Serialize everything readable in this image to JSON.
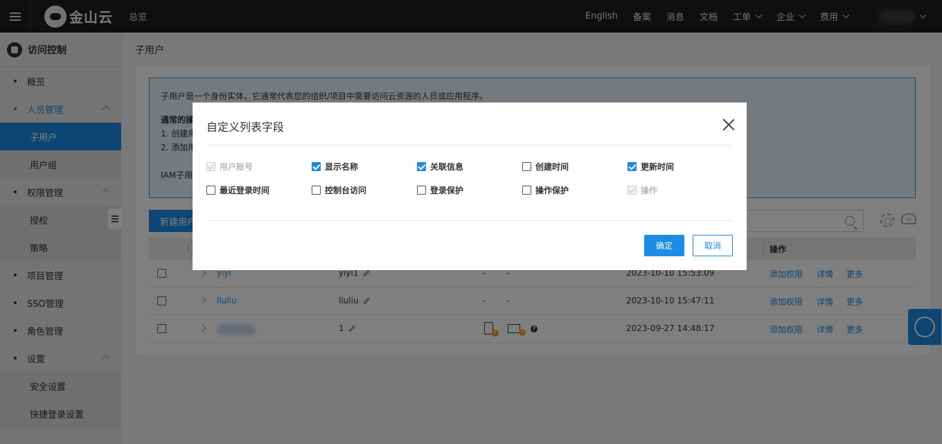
{
  "topbar": {
    "brand": "金山云",
    "overview": "总览",
    "items": [
      {
        "label": "English"
      },
      {
        "label": "备案"
      },
      {
        "label": "消息"
      },
      {
        "label": "文档"
      },
      {
        "label": "工单"
      },
      {
        "label": "企业"
      },
      {
        "label": "费用"
      }
    ]
  },
  "sidebar": {
    "title": "访问控制",
    "items": [
      {
        "label": "概览"
      },
      {
        "label": "人员管理"
      },
      {
        "label": "子用户"
      },
      {
        "label": "用户组"
      },
      {
        "label": "权限管理"
      },
      {
        "label": "授权"
      },
      {
        "label": "策略"
      },
      {
        "label": "项目管理"
      },
      {
        "label": "SSO管理"
      },
      {
        "label": "角色管理"
      },
      {
        "label": "设置"
      },
      {
        "label": "安全设置"
      },
      {
        "label": "快捷登录设置"
      }
    ]
  },
  "main": {
    "breadcrumb": "子用户",
    "info": {
      "line1": "子用户是一个身份实体，它通常代表您的组织/项目中需要访问云资源的人员或应用程序。",
      "heading": "通常的操",
      "step1": "1. 创建用",
      "step2": "2. 添加用",
      "footer": "IAM子用"
    },
    "new_button": "新建用户",
    "table": {
      "op_header": "操作",
      "rows": [
        {
          "user": "yiyi",
          "name": "yiyi1",
          "a": "-",
          "b": "-",
          "time": "2023-10-10 15:53:09",
          "op1": "添加权限",
          "op2": "详情",
          "op3": "更多"
        },
        {
          "user": "liuliu",
          "name": "liuliu",
          "a": "-",
          "b": "-",
          "time": "2023-10-10 15:47:11",
          "op1": "添加权限",
          "op2": "详情",
          "op3": "更多"
        },
        {
          "user": "",
          "name": "1",
          "a": "",
          "b": "",
          "time": "2023-09-27 14:48:17",
          "op1": "添加权限",
          "op2": "详情",
          "op3": "更多"
        }
      ]
    }
  },
  "modal": {
    "title": "自定义列表字段",
    "options": [
      {
        "label": "用户账号",
        "state": "disabled"
      },
      {
        "label": "显示名称",
        "state": "checked"
      },
      {
        "label": "关联信息",
        "state": "checked"
      },
      {
        "label": "创建时间",
        "state": "unchecked"
      },
      {
        "label": "更新时间",
        "state": "checked"
      },
      {
        "label": "最近登录时间",
        "state": "unchecked"
      },
      {
        "label": "控制台访问",
        "state": "unchecked"
      },
      {
        "label": "登录保护",
        "state": "unchecked"
      },
      {
        "label": "操作保护",
        "state": "unchecked"
      },
      {
        "label": "操作",
        "state": "disabled"
      }
    ],
    "ok": "确定",
    "cancel": "取消"
  },
  "colors": {
    "accent": "#1a8ce6",
    "topbar": "#1e1f21",
    "sidebar": "#e8e8e8"
  }
}
